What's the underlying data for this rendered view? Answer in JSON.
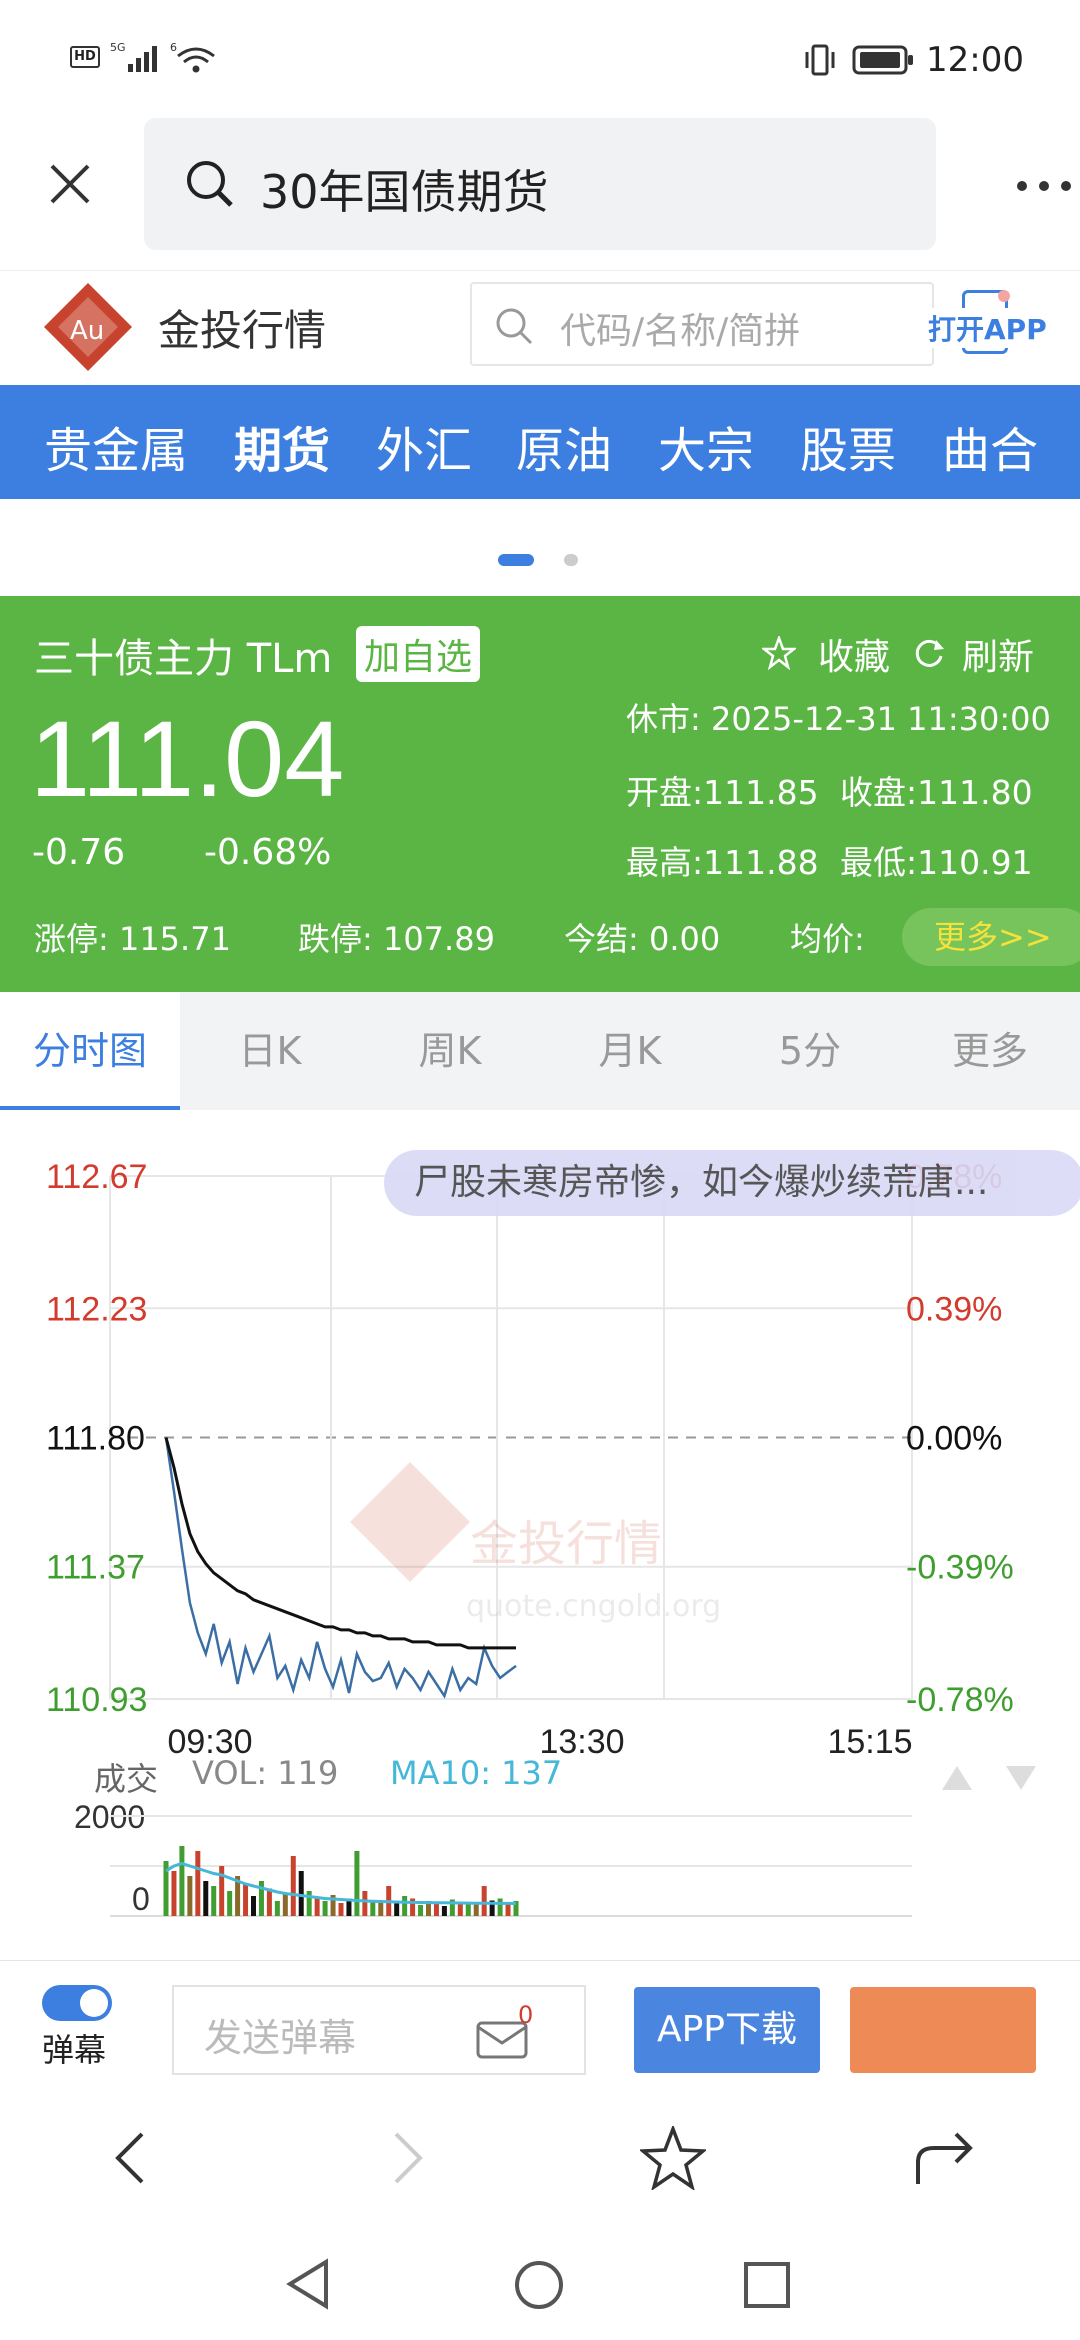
{
  "status": {
    "left_icons": [
      "hd-icon",
      "signal-5g-icon",
      "wifi-icon"
    ],
    "right_icons": [
      "vibrate-icon",
      "battery-icon"
    ],
    "time": "12:00"
  },
  "search": {
    "query": "30年国债期货"
  },
  "site": {
    "logo_text": "Au",
    "name": "金投行情",
    "placeholder": "代码/名称/简拼",
    "open_app": "打开APP"
  },
  "nav": {
    "items": [
      "贵金属",
      "期货",
      "外汇",
      "原油",
      "大宗",
      "股票",
      "曲合"
    ],
    "active_index": 1
  },
  "quote": {
    "name": "三十债主力 TLm",
    "add_watch": "加自选",
    "favorite": "收藏",
    "refresh": "刷新",
    "status_text": "休市: 2025-12-31 11:30:00",
    "price": "111.04",
    "change": "-0.76",
    "change_pct": "-0.68%",
    "open": "开盘:111.85",
    "close": "收盘:111.80",
    "high": "最高:111.88",
    "low": "最低:110.91",
    "limit_up": "涨停: 115.71",
    "limit_down": "跌停: 107.89",
    "settle": "今结: 0.00",
    "avg_label": "均价:",
    "more": "更多>>"
  },
  "tabs": {
    "items": [
      "分时图",
      "日K",
      "周K",
      "月K",
      "5分",
      "更多"
    ],
    "active_index": 0
  },
  "chart": {
    "danmaku": "尸股未寒房帝惨，如今爆炒续荒唐...",
    "watermark_brand": "金投行情",
    "watermark_url": "quote.cngold.org",
    "volume_label": "成交",
    "vol_text": "VOL: 119",
    "ma_text": "MA10: 137",
    "vol_ticks": [
      "2000",
      "0"
    ]
  },
  "chart_data": {
    "type": "line",
    "title": "",
    "x_labels": [
      "09:30",
      "13:30",
      "15:15"
    ],
    "y_ticks": [
      112.67,
      112.23,
      111.8,
      111.37,
      110.93
    ],
    "y_tick_labels": [
      "112.67",
      "112.23",
      "111.80",
      "111.37",
      "110.93"
    ],
    "pct_ticks": [
      "0.78%",
      "0.39%",
      "0.00%",
      "-0.39%",
      "-0.78%"
    ],
    "prev_close": 111.8,
    "ylim": [
      110.93,
      112.67
    ],
    "grid": true,
    "series": [
      {
        "values": [
          111.8,
          111.62,
          111.43,
          111.25,
          111.15,
          111.08,
          111.18,
          111.05,
          111.12,
          110.98,
          111.1,
          111.02,
          111.08,
          111.14,
          111.0,
          111.04,
          110.96,
          111.06,
          111.0,
          111.12,
          111.03,
          110.97,
          111.06,
          110.95,
          111.08,
          111.02,
          110.99,
          111.0,
          111.05,
          110.97,
          111.03,
          111.0,
          110.96,
          111.02,
          110.98,
          110.94,
          111.03,
          110.96,
          111.0,
          110.98,
          111.1,
          111.04,
          111.0,
          111.02,
          111.04
        ]
      },
      {
        "values": [
          111.8,
          111.7,
          111.58,
          111.48,
          111.42,
          111.38,
          111.35,
          111.33,
          111.31,
          111.29,
          111.28,
          111.26,
          111.25,
          111.24,
          111.23,
          111.22,
          111.21,
          111.2,
          111.19,
          111.18,
          111.17,
          111.17,
          111.16,
          111.16,
          111.15,
          111.15,
          111.14,
          111.14,
          111.13,
          111.13,
          111.13,
          111.12,
          111.12,
          111.12,
          111.11,
          111.11,
          111.11,
          111.11,
          111.1,
          111.1,
          111.1,
          111.1,
          111.1,
          111.1,
          111.1
        ]
      }
    ],
    "volume": [
      1100,
      900,
      1400,
      800,
      1300,
      700,
      600,
      1000,
      500,
      800,
      650,
      400,
      700,
      550,
      300,
      450,
      1200,
      900,
      500,
      380,
      300,
      420,
      260,
      350,
      1300,
      500,
      320,
      280,
      600,
      250,
      400,
      350,
      220,
      300,
      260,
      200,
      330,
      280,
      240,
      260,
      600,
      310,
      350,
      280,
      300
    ],
    "volume_ma": [
      900,
      1000,
      1050,
      1000,
      950,
      900,
      850,
      820,
      760,
      700,
      640,
      600,
      560,
      520,
      480,
      450,
      430,
      410,
      390,
      370,
      350,
      340,
      330,
      320,
      310,
      300,
      295,
      290,
      285,
      280,
      275,
      272,
      270,
      268,
      266,
      264,
      262,
      260,
      258,
      256,
      255,
      254,
      253,
      252,
      250
    ],
    "vol_max": 2000
  },
  "bottom": {
    "danmaku_label": "弹幕",
    "danmaku_placeholder": "发送弹幕",
    "msg_count": "0",
    "app_download": "APP下载",
    "orange_button": ""
  },
  "colors": {
    "nav_blue": "#3d7fe0",
    "quote_green": "#5bb545",
    "up_red": "#d23b2d",
    "down_green": "#3f9e2f",
    "price_line": "#3a6ea5",
    "avg_line": "#111111",
    "ma_line": "#45b7d8",
    "app_btn": "#4a86e0",
    "orange": "#ee8a55"
  }
}
